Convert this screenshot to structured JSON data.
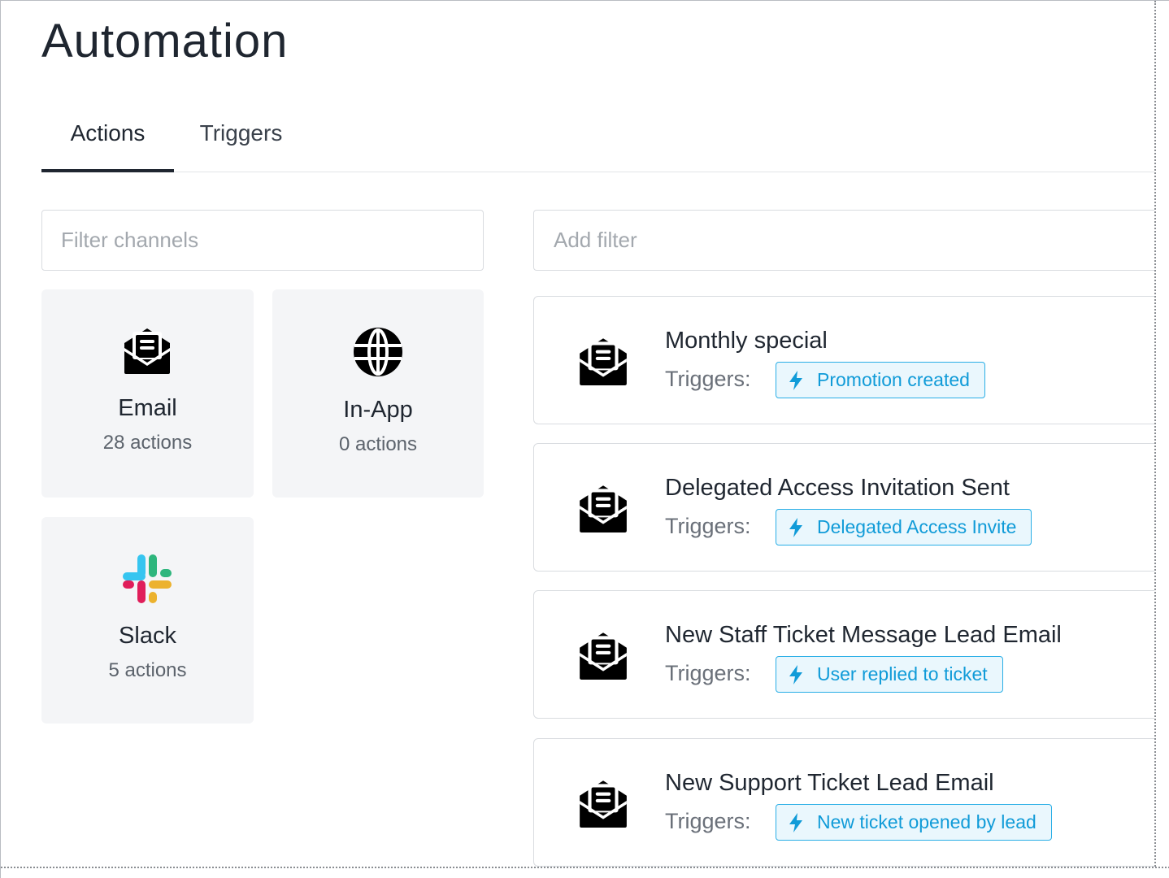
{
  "page": {
    "title": "Automation"
  },
  "tabs": [
    {
      "label": "Actions",
      "active": true
    },
    {
      "label": "Triggers",
      "active": false
    }
  ],
  "channels_filter": {
    "placeholder": "Filter channels"
  },
  "actions_filter": {
    "placeholder": "Add filter"
  },
  "channels": [
    {
      "name": "Email",
      "count": "28 actions",
      "icon": "envelope-open-text-icon"
    },
    {
      "name": "In-App",
      "count": "0 actions",
      "icon": "globe-icon"
    },
    {
      "name": "Slack",
      "count": "5 actions",
      "icon": "slack-logo-icon"
    }
  ],
  "actions": [
    {
      "title": "Monthly special",
      "triggers_label": "Triggers:",
      "trigger": "Promotion created",
      "icon": "envelope-open-text-icon"
    },
    {
      "title": "Delegated Access Invitation Sent",
      "triggers_label": "Triggers:",
      "trigger": "Delegated Access Invite",
      "icon": "envelope-open-text-icon"
    },
    {
      "title": "New Staff Ticket Message Lead Email",
      "triggers_label": "Triggers:",
      "trigger": "User replied to ticket",
      "icon": "envelope-open-text-icon"
    },
    {
      "title": "New Support Ticket Lead Email",
      "triggers_label": "Triggers:",
      "trigger": "New ticket opened by lead",
      "icon": "envelope-open-text-icon"
    }
  ],
  "colors": {
    "text": "#1f2630",
    "card_bg": "#f4f5f7",
    "badge_border": "#29aee6",
    "badge_text": "#109bd8",
    "badge_bg": "#eaf7fd",
    "slack_blue": "#36c5f0",
    "slack_green": "#2eb67d",
    "slack_red": "#e01e5a",
    "slack_yellow": "#ecb22e"
  }
}
